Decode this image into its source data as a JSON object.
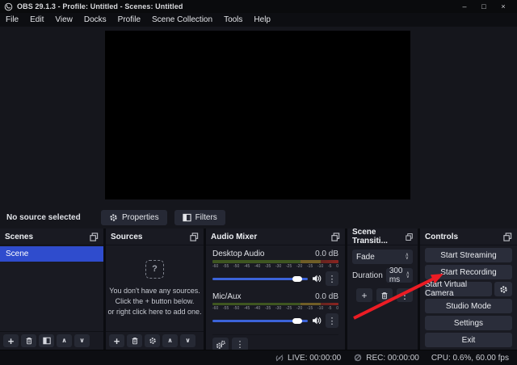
{
  "window": {
    "title": "OBS 29.1.3 - Profile: Untitled - Scenes: Untitled",
    "minimize": "–",
    "maximize": "□",
    "close": "×"
  },
  "menu": {
    "items": [
      "File",
      "Edit",
      "View",
      "Docks",
      "Profile",
      "Scene Collection",
      "Tools",
      "Help"
    ]
  },
  "context": {
    "status": "No source selected",
    "properties": "Properties",
    "filters": "Filters"
  },
  "scenes": {
    "title": "Scenes",
    "selected_scene": "Scene"
  },
  "sources": {
    "title": "Sources",
    "empty_icon": "?",
    "empty_line1": "You don't have any sources.",
    "empty_line2": "Click the + button below.",
    "empty_line3": "or right click here to add one."
  },
  "audio_mixer": {
    "title": "Audio Mixer",
    "channels": [
      {
        "name": "Desktop Audio",
        "level": "0.0 dB"
      },
      {
        "name": "Mic/Aux",
        "level": "0.0 dB"
      }
    ],
    "ticks": [
      "-60",
      "-55",
      "-50",
      "-45",
      "-40",
      "-35",
      "-30",
      "-25",
      "-20",
      "-15",
      "-10",
      "-5",
      "0"
    ]
  },
  "transitions": {
    "title": "Scene Transiti...",
    "selected": "Fade",
    "duration_label": "Duration",
    "duration": "300 ms"
  },
  "controls": {
    "title": "Controls",
    "buttons": [
      "Start Streaming",
      "Start Recording",
      "Start Virtual Camera",
      "Studio Mode",
      "Settings",
      "Exit"
    ]
  },
  "status": {
    "live": "LIVE: 00:00:00",
    "rec": "REC: 00:00:00",
    "cpu": "CPU: 0.6%, 60.00 fps"
  },
  "icons": {
    "plus": "+",
    "up": "∧",
    "down": "∨",
    "kebab": "⋮",
    "spin_up": "∧",
    "spin_down": "∨"
  },
  "colors": {
    "selection_blue": "#2f4ccd",
    "slider_blue": "#3c63d9",
    "arrow_red": "#ec1c24"
  }
}
